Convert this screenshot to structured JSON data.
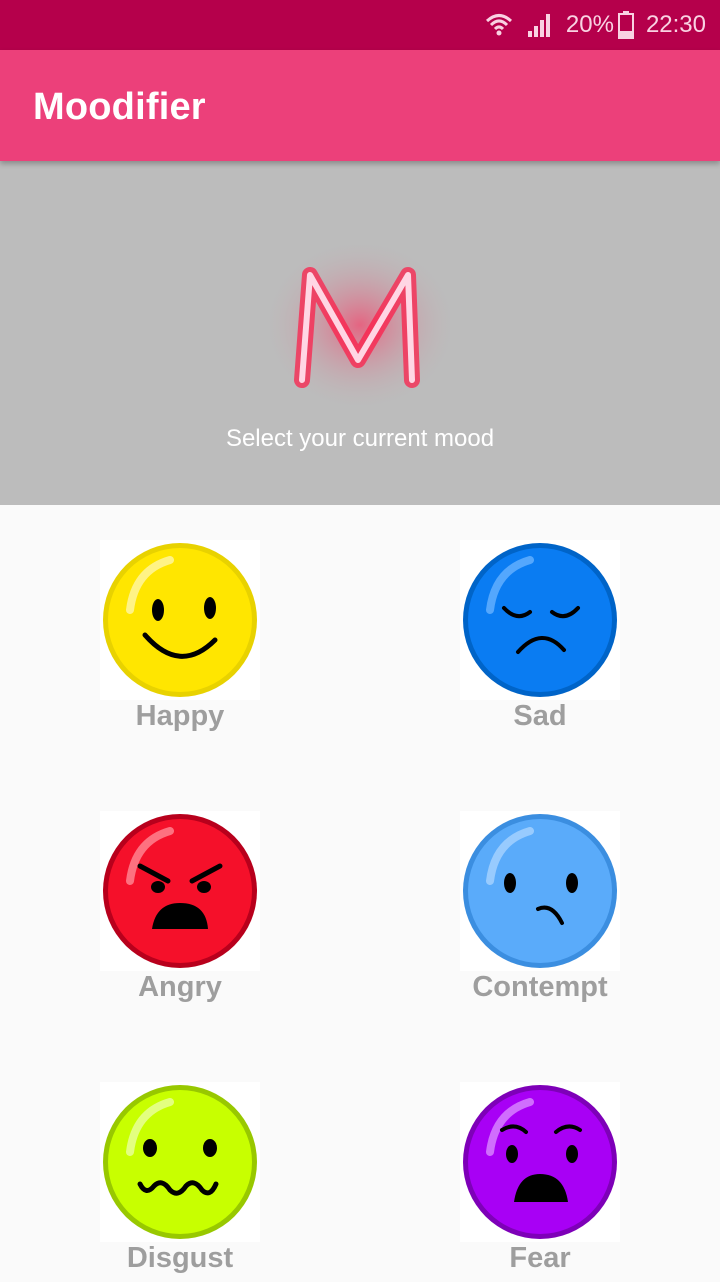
{
  "status_bar": {
    "battery_text": "20%",
    "time": "22:30",
    "icons": [
      "wifi-icon",
      "signal-icon",
      "battery-icon"
    ],
    "color": "#b5004b"
  },
  "app_bar": {
    "title": "Moodifier",
    "color": "#ec407a"
  },
  "hero": {
    "logo_letter": "M",
    "subtitle": "Select your current mood",
    "background": "#bcbcbc"
  },
  "moods": [
    {
      "label": "Happy",
      "icon": "happy-face-icon",
      "color": "#ffe600"
    },
    {
      "label": "Sad",
      "icon": "sad-face-icon",
      "color": "#0a7cf2"
    },
    {
      "label": "Angry",
      "icon": "angry-face-icon",
      "color": "#f5102a"
    },
    {
      "label": "Contempt",
      "icon": "contempt-face-icon",
      "color": "#5aabfa"
    },
    {
      "label": "Disgust",
      "icon": "disgust-face-icon",
      "color": "#c8ff00"
    },
    {
      "label": "Fear",
      "icon": "fear-face-icon",
      "color": "#a800f5"
    }
  ]
}
